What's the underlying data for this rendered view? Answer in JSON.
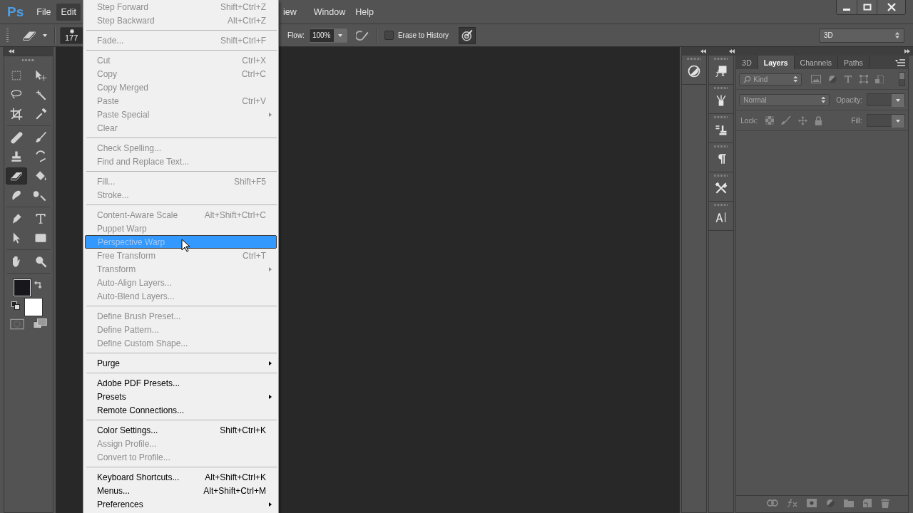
{
  "app": {
    "logo": "Ps"
  },
  "menu_bar": [
    {
      "label": "File",
      "selected": false
    },
    {
      "label": "Edit",
      "selected": true
    },
    {
      "label": "iew",
      "selected": false
    },
    {
      "label": "Window",
      "selected": false
    },
    {
      "label": "Help",
      "selected": false
    }
  ],
  "options_bar": {
    "brush_size": "177",
    "flow_label": "Flow:",
    "flow_value": "100%",
    "erase_to_history": {
      "label": "Erase to History",
      "checked": false
    },
    "pressure_button": {
      "on": true
    },
    "workspace": "3D"
  },
  "tool_groups": [
    [
      {
        "kind": "marquee",
        "selected": false
      },
      {
        "kind": "move",
        "selected": false
      },
      {
        "kind": "lasso",
        "selected": false
      },
      {
        "kind": "wand",
        "selected": false
      },
      {
        "kind": "crop",
        "selected": false
      },
      {
        "kind": "eyedropper",
        "selected": false
      }
    ],
    [
      {
        "kind": "healing",
        "selected": false
      },
      {
        "kind": "brush",
        "selected": false
      },
      {
        "kind": "stamp",
        "selected": false
      },
      {
        "kind": "history",
        "selected": false
      },
      {
        "kind": "eraser",
        "selected": true
      },
      {
        "kind": "bucket",
        "selected": false
      },
      {
        "kind": "smudge",
        "selected": false
      },
      {
        "kind": "dodge",
        "selected": false
      }
    ],
    [
      {
        "kind": "pen",
        "selected": false
      },
      {
        "kind": "type",
        "selected": false
      },
      {
        "kind": "select",
        "selected": false
      },
      {
        "kind": "shape",
        "selected": false
      }
    ],
    [
      {
        "kind": "hand",
        "selected": false
      },
      {
        "kind": "zoom",
        "selected": false
      }
    ]
  ],
  "dock_columns": [
    [
      {
        "kind": "adjustments"
      }
    ],
    [
      {
        "kind": "styles"
      },
      {
        "kind": "brushes"
      },
      {
        "kind": "clone"
      },
      {
        "kind": "paragraph"
      },
      {
        "kind": "presets"
      },
      {
        "kind": "character"
      }
    ]
  ],
  "layers_panel": {
    "tabs": [
      {
        "label": "3D",
        "selected": false
      },
      {
        "label": "Layers",
        "selected": true
      },
      {
        "label": "Channels",
        "selected": false
      },
      {
        "label": "Paths",
        "selected": false
      }
    ],
    "filter": "Kind",
    "blend_mode": "Normal",
    "opacity_label": "Opacity:",
    "lock_label": "Lock:",
    "fill_label": "Fill:"
  },
  "edit_menu": [
    [
      {
        "label": "Step Forward",
        "shortcut": "Shift+Ctrl+Z",
        "submenu": false,
        "disabled": true,
        "selected": false
      },
      {
        "label": "Step Backward",
        "shortcut": "Alt+Ctrl+Z",
        "submenu": false,
        "disabled": true,
        "selected": false
      }
    ],
    [
      {
        "label": "Fade...",
        "shortcut": "Shift+Ctrl+F",
        "submenu": false,
        "disabled": true,
        "selected": false
      }
    ],
    [
      {
        "label": "Cut",
        "shortcut": "Ctrl+X",
        "submenu": false,
        "disabled": true,
        "selected": false
      },
      {
        "label": "Copy",
        "shortcut": "Ctrl+C",
        "submenu": false,
        "disabled": true,
        "selected": false
      },
      {
        "label": "Copy Merged",
        "submenu": false,
        "disabled": true,
        "selected": false
      },
      {
        "label": "Paste",
        "shortcut": "Ctrl+V",
        "submenu": false,
        "disabled": true,
        "selected": false
      },
      {
        "label": "Paste Special",
        "submenu": true,
        "disabled": true,
        "selected": false
      },
      {
        "label": "Clear",
        "submenu": false,
        "disabled": true,
        "selected": false
      }
    ],
    [
      {
        "label": "Check Spelling...",
        "submenu": false,
        "disabled": true,
        "selected": false
      },
      {
        "label": "Find and Replace Text...",
        "submenu": false,
        "disabled": true,
        "selected": false
      }
    ],
    [
      {
        "label": "Fill...",
        "shortcut": "Shift+F5",
        "submenu": false,
        "disabled": true,
        "selected": false
      },
      {
        "label": "Stroke...",
        "submenu": false,
        "disabled": true,
        "selected": false
      }
    ],
    [
      {
        "label": "Content-Aware Scale",
        "shortcut": "Alt+Shift+Ctrl+C",
        "submenu": false,
        "disabled": true,
        "selected": false
      },
      {
        "label": "Puppet Warp",
        "submenu": false,
        "disabled": true,
        "selected": false
      },
      {
        "label": "Perspective Warp",
        "submenu": false,
        "disabled": true,
        "selected": true
      },
      {
        "label": "Free Transform",
        "shortcut": "Ctrl+T",
        "submenu": false,
        "disabled": true,
        "selected": false
      },
      {
        "label": "Transform",
        "submenu": true,
        "disabled": true,
        "selected": false
      },
      {
        "label": "Auto-Align Layers...",
        "submenu": false,
        "disabled": true,
        "selected": false
      },
      {
        "label": "Auto-Blend Layers...",
        "submenu": false,
        "disabled": true,
        "selected": false
      }
    ],
    [
      {
        "label": "Define Brush Preset...",
        "submenu": false,
        "disabled": true,
        "selected": false
      },
      {
        "label": "Define Pattern...",
        "submenu": false,
        "disabled": true,
        "selected": false
      },
      {
        "label": "Define Custom Shape...",
        "submenu": false,
        "disabled": true,
        "selected": false
      }
    ],
    [
      {
        "label": "Purge",
        "submenu": true,
        "disabled": false,
        "selected": false
      }
    ],
    [
      {
        "label": "Adobe PDF Presets...",
        "submenu": false,
        "disabled": false,
        "selected": false
      },
      {
        "label": "Presets",
        "submenu": true,
        "disabled": false,
        "selected": false
      },
      {
        "label": "Remote Connections...",
        "submenu": false,
        "disabled": false,
        "selected": false
      }
    ],
    [
      {
        "label": "Color Settings...",
        "shortcut": "Shift+Ctrl+K",
        "submenu": false,
        "disabled": false,
        "selected": false
      },
      {
        "label": "Assign Profile...",
        "submenu": false,
        "disabled": true,
        "selected": false
      },
      {
        "label": "Convert to Profile...",
        "submenu": false,
        "disabled": true,
        "selected": false
      }
    ],
    [
      {
        "label": "Keyboard Shortcuts...",
        "shortcut": "Alt+Shift+Ctrl+K",
        "submenu": false,
        "disabled": false,
        "selected": false
      },
      {
        "label": "Menus...",
        "shortcut": "Alt+Shift+Ctrl+M",
        "submenu": false,
        "disabled": false,
        "selected": false
      },
      {
        "label": "Preferences",
        "submenu": true,
        "disabled": false,
        "selected": false
      }
    ]
  ]
}
